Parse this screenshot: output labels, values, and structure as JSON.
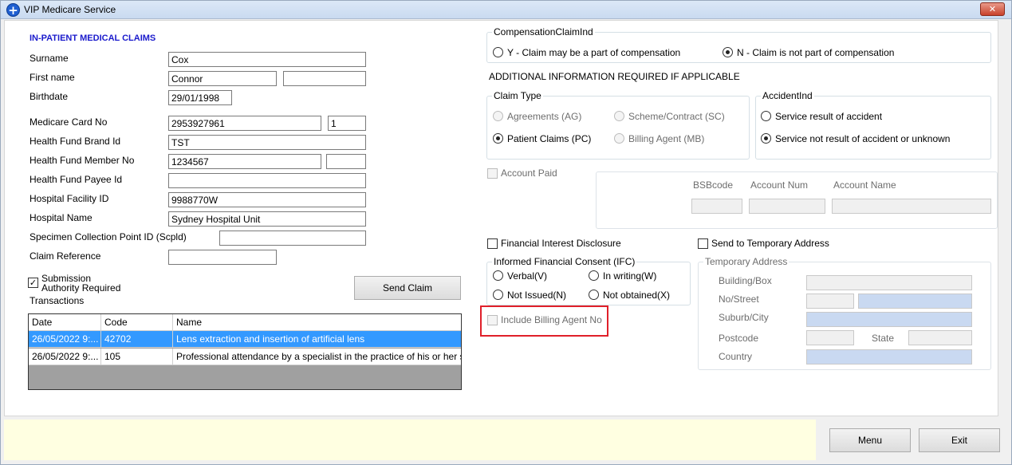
{
  "window": {
    "title": "VIP Medicare Service",
    "close_glyph": "✕"
  },
  "form": {
    "heading": "IN-PATIENT MEDICAL CLAIMS",
    "surname_label": "Surname",
    "surname": "Cox",
    "firstname_label": "First name",
    "firstname": "Connor",
    "secondname": "",
    "birthdate_label": "Birthdate",
    "birthdate": "29/01/1998",
    "medicare_label": "Medicare Card No",
    "medicare": "2953927961",
    "medicare_irn": "1",
    "fund_brand_label": "Health Fund Brand Id",
    "fund_brand": "TST",
    "fund_member_label": "Health Fund Member No",
    "fund_member": "1234567",
    "fund_member_extra": "",
    "fund_payee_label": "Health Fund Payee Id",
    "fund_payee": "",
    "facility_label": "Hospital Facility ID",
    "facility": "9988770W",
    "hospital_name_label": "Hospital Name",
    "hospital_name": "Sydney Hospital Unit",
    "specimen_label": "Specimen Collection Point ID (Scpld)",
    "specimen": "",
    "claim_ref_label": "Claim Reference",
    "claim_ref": "",
    "submission_label_1": "Submission",
    "submission_label_2": "Authority Required",
    "submission_check": "✓",
    "send_claim": "Send Claim",
    "transactions_label": "Transactions"
  },
  "transactions": {
    "headers": [
      "Date",
      "Code",
      "Name"
    ],
    "rows": [
      {
        "date": "26/05/2022 9:...",
        "code": "42702",
        "name": "Lens extraction and insertion of artificial lens"
      },
      {
        "date": "26/05/2022 9:...",
        "code": "105",
        "name": "Professional attendance by a specialist in the practice of his or her speci..."
      }
    ]
  },
  "right": {
    "comp_title": "CompensationClaimInd",
    "comp_y": "Y - Claim may be a part of compensation",
    "comp_n": "N - Claim is not part of compensation",
    "additional": "ADDITIONAL INFORMATION REQUIRED IF APPLICABLE",
    "claim_type_title": "Claim Type",
    "ct_ag": "Agreements (AG)",
    "ct_sc": "Scheme/Contract (SC)",
    "ct_pc": "Patient Claims (PC)",
    "ct_mb": "Billing Agent (MB)",
    "accident_title": "AccidentInd",
    "acc_yes": "Service result of accident",
    "acc_no": "Service not result of accident or unknown",
    "account_paid": "Account Paid",
    "bsb_label": "BSBcode",
    "acct_num_label": "Account Num",
    "acct_name_label": "Account Name",
    "fin_interest": "Financial Interest Disclosure",
    "temp_address": "Send to Temporary Address",
    "ifc_title": "Informed Financial Consent (IFC)",
    "ifc_verbal": "Verbal(V)",
    "ifc_writing": "In writing(W)",
    "ifc_not_issued": "Not Issued(N)",
    "ifc_not_obtained": "Not obtained(X)",
    "include_billing": "Include Billing Agent No",
    "temp_title": "Temporary Address",
    "building_label": "Building/Box",
    "street_label": "No/Street",
    "suburb_label": "Suburb/City",
    "postcode_label": "Postcode",
    "state_label": "State",
    "country_label": "Country"
  },
  "footer": {
    "menu": "Menu",
    "exit": "Exit"
  }
}
